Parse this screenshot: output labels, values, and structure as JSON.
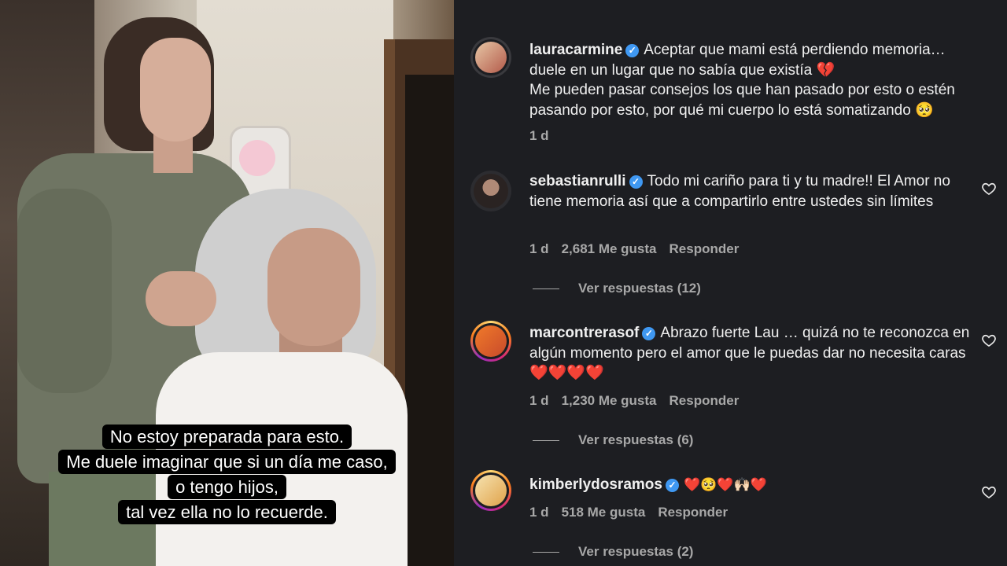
{
  "video": {
    "subtitles": [
      "No estoy preparada para esto.",
      "Me duele imaginar que si un día me caso,",
      "o tengo hijos,",
      "tal vez ella no lo recuerde."
    ]
  },
  "comments": [
    {
      "username": "lauracarmine",
      "verified": true,
      "text": "Aceptar que mami está perdiendo memoria… duele en un lugar que no sabía que existía 💔",
      "text2": "Me pueden pasar consejos los que han pasado por esto o estén pasando por esto, por qué mi cuerpo lo está somatizando 🥺",
      "time": "1 d"
    },
    {
      "username": "sebastianrulli",
      "verified": true,
      "text": "Todo mi cariño para ti y tu madre!! El Amor no tiene memoria así que a compartirlo entre ustedes sin límites",
      "time": "1 d",
      "likes": "2,681 Me gusta",
      "reply": "Responder",
      "view_replies": "Ver respuestas (12)"
    },
    {
      "username": "marcontrerasof",
      "verified": true,
      "text": "Abrazo fuerte Lau … quizá no te reconozca en algún momento pero el amor que le puedas dar no necesita caras ❤️❤️❤️❤️",
      "time": "1 d",
      "likes": "1,230 Me gusta",
      "reply": "Responder",
      "view_replies": "Ver respuestas (6)"
    },
    {
      "username": "kimberlydosramos",
      "verified": true,
      "text": "❤️🥺❤️🙌🏻❤️",
      "time": "1 d",
      "likes": "518 Me gusta",
      "reply": "Responder",
      "view_replies": "Ver respuestas (2)"
    }
  ],
  "icons": {
    "verified": "verified-badge-icon",
    "like": "heart-outline-icon"
  },
  "colors": {
    "panel_bg": "#1d1e22",
    "verified": "#3f98f2",
    "muted": "#a8a8a8"
  }
}
